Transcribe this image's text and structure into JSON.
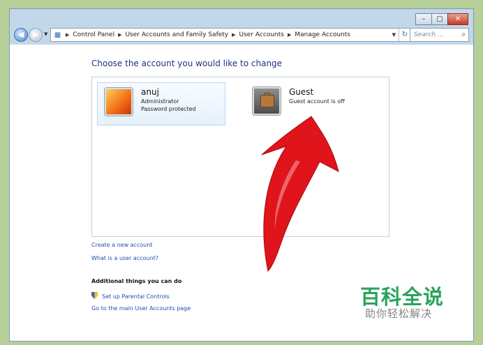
{
  "window": {
    "caption": {
      "minimize": "–",
      "maximize": "□",
      "close": "✕"
    }
  },
  "nav": {
    "back_icon": "back-arrow-icon",
    "forward_icon": "forward-arrow-icon",
    "breadcrumb": [
      "Control Panel",
      "User Accounts and Family Safety",
      "User Accounts",
      "Manage Accounts"
    ],
    "search_placeholder": "Search ..."
  },
  "main": {
    "heading": "Choose the account you would like to change",
    "accounts": [
      {
        "name": "anuj",
        "line1": "Administrator",
        "line2": "Password protected"
      },
      {
        "name": "Guest",
        "line1": "Guest account is off"
      }
    ],
    "links": {
      "create_account": "Create a new account",
      "what_is_account": "What is a user account?"
    },
    "additional": {
      "title": "Additional things you can do",
      "parental_controls": "Set up Parental Controls",
      "main_page": "Go to the main User Accounts page"
    }
  },
  "overlay": {
    "arrow_color": "#e0141b",
    "watermark_title": "百科全说",
    "watermark_subtitle": "助你轻松解决"
  }
}
